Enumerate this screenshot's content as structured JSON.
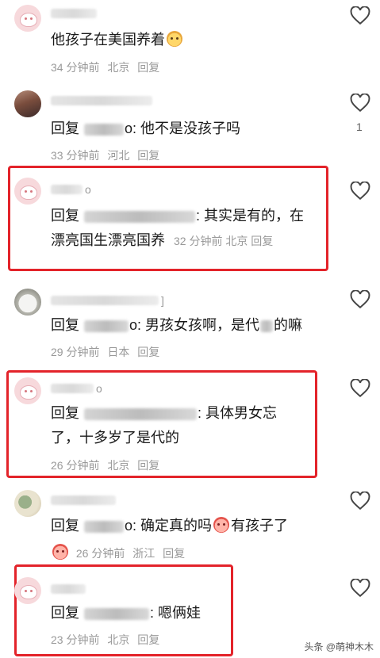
{
  "comments": [
    {
      "text": "他孩子在美国养着",
      "time": "34 分钟前",
      "location": "北京",
      "reply_label": "回复"
    },
    {
      "reply_prefix": "回复",
      "mention_tail": "o:",
      "text": "他不是没孩子吗",
      "time": "33 分钟前",
      "location": "河北",
      "reply_label": "回复",
      "likes": "1"
    },
    {
      "name_tail": "o",
      "reply_prefix": "回复",
      "line1": "其实是有的，在",
      "line2": "漂亮国生漂亮国养",
      "time": "32 分钟前",
      "location": "北京",
      "reply_label": "回复"
    },
    {
      "name_tail": "]",
      "reply_prefix": "回复",
      "mention_tail": "o:",
      "text_a": "男孩女孩啊，是代",
      "text_b": "的嘛",
      "time": "29 分钟前",
      "location": "日本",
      "reply_label": "回复"
    },
    {
      "name_tail": "o",
      "reply_prefix": "回复",
      "line1": "具体男女忘",
      "line2": "了，十多岁了是代的",
      "time": "26 分钟前",
      "location": "北京",
      "reply_label": "回复"
    },
    {
      "reply_prefix": "回复",
      "mention_tail": "o:",
      "text_a": "确定真的吗",
      "text_b": "有孩子了",
      "time": "26 分钟前",
      "location": "浙江",
      "reply_label": "回复"
    },
    {
      "reply_prefix": "回复",
      "text": "嗯俩娃",
      "time": "23 分钟前",
      "location": "北京",
      "reply_label": "回复"
    }
  ],
  "watermark": "头条 @萌神木木",
  "colors": {
    "highlight_box": "#e3232a",
    "meta_text": "#999999"
  },
  "icons": {
    "like": "heart-outline-icon"
  }
}
